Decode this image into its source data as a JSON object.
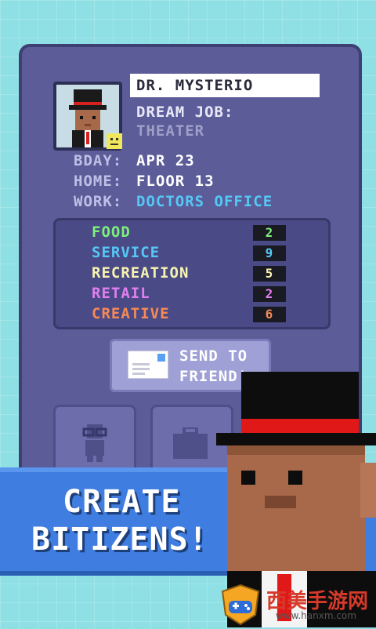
{
  "profile": {
    "name": "DR. MYSTERIO",
    "dream_job_label": "DREAM JOB:",
    "dream_job": "THEATER",
    "bday_label": "BDAY:",
    "bday": "APR 23",
    "home_label": "HOME:",
    "home": "FLOOR 13",
    "work_label": "WORK:",
    "work": "DOCTORS OFFICE"
  },
  "skills": [
    {
      "name": "FOOD",
      "value": "2",
      "color": "#7df07a"
    },
    {
      "name": "SERVICE",
      "value": "9",
      "color": "#55c8f5"
    },
    {
      "name": "RECREATION",
      "value": "5",
      "color": "#f8f4b0"
    },
    {
      "name": "RETAIL",
      "value": "2",
      "color": "#e27ef0"
    },
    {
      "name": "CREATIVE",
      "value": "6",
      "color": "#f58a55"
    }
  ],
  "send_button": {
    "line1": "SEND TO",
    "line2": "FRIEND!"
  },
  "banner": {
    "line1": "CREATE",
    "line2": "BITIZENS!"
  },
  "watermark": {
    "text": "西美手游网",
    "url": "www.hanxm.com"
  },
  "colors": {
    "work_value": "#55c8f5",
    "banner": "#3f7de0",
    "card": "#5b5c98"
  }
}
